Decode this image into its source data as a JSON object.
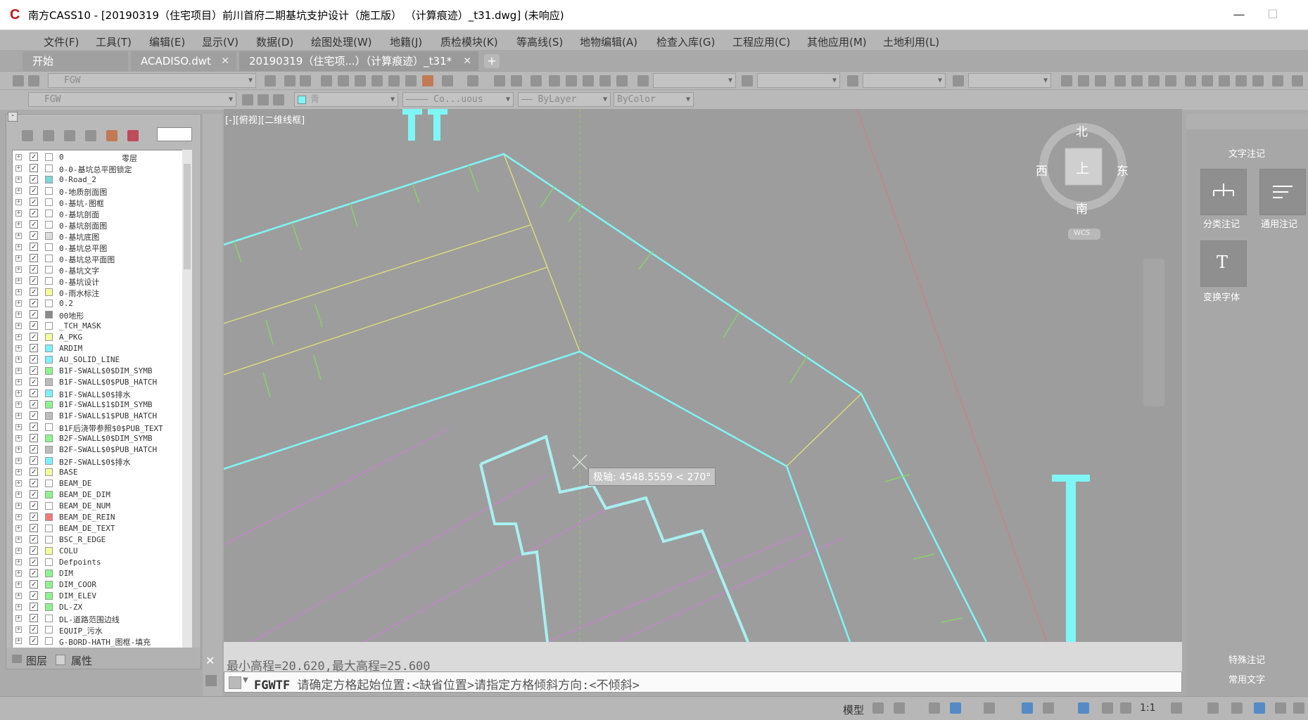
{
  "window": {
    "title": "南方CASS10 - [20190319（住宅项目）前川首府二期基坑支护设计（施工版） （计算痕迹）_t31.dwg] (未响应)",
    "minimize": "—",
    "maximize": "☐",
    "close": ""
  },
  "menu": [
    "文件(F)",
    "工具(T)",
    "编辑(E)",
    "显示(V)",
    "数据(D)",
    "绘图处理(W)",
    "地籍(J)",
    "质检模块(K)",
    "等高线(S)",
    "地物编辑(A)",
    "检查入库(G)",
    "工程应用(C)",
    "其他应用(M)",
    "土地利用(L)"
  ],
  "tabs": [
    {
      "label": "开始"
    },
    {
      "label": "ACADISO.dwt"
    },
    {
      "label": "20190319（住宅项...）（计算痕迹）_t31*"
    }
  ],
  "tab_add": "+",
  "toolbar": {
    "layer_combo_1": "FGW",
    "layer_combo_2": "FGW",
    "color_combo": "青",
    "linetype_combo": "———— Co...uous",
    "lineweight_combo": "—— ByLayer",
    "plotstyle_combo": "ByColor"
  },
  "layers": [
    {
      "name": "0",
      "desc": "零层",
      "color": "#ffffff"
    },
    {
      "name": "0-0-基坑总平图锁定",
      "desc": "",
      "color": "#ffffff"
    },
    {
      "name": "0-Road_2",
      "desc": "",
      "color": "#7fd6d6"
    },
    {
      "name": "0-地质剖面图",
      "desc": "",
      "color": "#ffffff"
    },
    {
      "name": "0-基坑-图框",
      "desc": "",
      "color": "#ffffff"
    },
    {
      "name": "0-基坑剖面",
      "desc": "",
      "color": "#ffffff"
    },
    {
      "name": "0-基坑剖面图",
      "desc": "",
      "color": "#ffffff"
    },
    {
      "name": "0-基坑底图",
      "desc": "",
      "color": "#dddddd"
    },
    {
      "name": "0-基坑总平图",
      "desc": "",
      "color": "#ffffff"
    },
    {
      "name": "0-基坑总平面图",
      "desc": "",
      "color": "#ffffff"
    },
    {
      "name": "0-基坑文字",
      "desc": "",
      "color": "#ffffff"
    },
    {
      "name": "0-基坑设计",
      "desc": "",
      "color": "#ffffff"
    },
    {
      "name": "0-雨水标注",
      "desc": "",
      "color": "#f4ff9a"
    },
    {
      "name": "0.2",
      "desc": "",
      "color": "#ffffff"
    },
    {
      "name": "00地形",
      "desc": "",
      "color": "#8a8a8a"
    },
    {
      "name": "_TCH_MASK",
      "desc": "",
      "color": "#ffffff"
    },
    {
      "name": "A_PKG",
      "desc": "",
      "color": "#f4ff9a"
    },
    {
      "name": "ARDIM",
      "desc": "",
      "color": "#7ff0ff"
    },
    {
      "name": "AU_SOLID_LINE",
      "desc": "",
      "color": "#7ff0ff"
    },
    {
      "name": "B1F-SWALL$0$DIM_SYMB",
      "desc": "",
      "color": "#8cf58c"
    },
    {
      "name": "B1F-SWALL$0$PUB_HATCH",
      "desc": "",
      "color": "#bdbdbd"
    },
    {
      "name": "B1F-SWALL$0$排水",
      "desc": "",
      "color": "#7ff0ff"
    },
    {
      "name": "B1F-SWALL$1$DIM_SYMB",
      "desc": "",
      "color": "#8cf58c"
    },
    {
      "name": "B1F-SWALL$1$PUB_HATCH",
      "desc": "",
      "color": "#bdbdbd"
    },
    {
      "name": "B1F后浇带参照$0$PUB_TEXT",
      "desc": "",
      "color": "#ffffff"
    },
    {
      "name": "B2F-SWALL$0$DIM_SYMB",
      "desc": "",
      "color": "#8cf58c"
    },
    {
      "name": "B2F-SWALL$0$PUB_HATCH",
      "desc": "",
      "color": "#bdbdbd"
    },
    {
      "name": "B2F-SWALL$0$排水",
      "desc": "",
      "color": "#7ff0ff"
    },
    {
      "name": "BASE",
      "desc": "",
      "color": "#f4ff9a"
    },
    {
      "name": "BEAM_DE",
      "desc": "",
      "color": "#ffffff"
    },
    {
      "name": "BEAM_DE_DIM",
      "desc": "",
      "color": "#8cf58c"
    },
    {
      "name": "BEAM_DE_NUM",
      "desc": "",
      "color": "#ffffff"
    },
    {
      "name": "BEAM_DE_REIN",
      "desc": "",
      "color": "#f07a7a"
    },
    {
      "name": "BEAM_DE_TEXT",
      "desc": "",
      "color": "#ffffff"
    },
    {
      "name": "BSC_R_EDGE",
      "desc": "",
      "color": "#ffffff"
    },
    {
      "name": "COLU",
      "desc": "",
      "color": "#f4ff9a"
    },
    {
      "name": "Defpoints",
      "desc": "",
      "color": "#ffffff"
    },
    {
      "name": "DIM",
      "desc": "",
      "color": "#8cf58c"
    },
    {
      "name": "DIM_COOR",
      "desc": "",
      "color": "#8cf58c"
    },
    {
      "name": "DIM_ELEV",
      "desc": "",
      "color": "#8cf58c"
    },
    {
      "name": "DL-ZX",
      "desc": "",
      "color": "#8cf58c"
    },
    {
      "name": "DL-道路范围边线",
      "desc": "",
      "color": "#ffffff"
    },
    {
      "name": "EQUIP_污水",
      "desc": "",
      "color": "#ffffff"
    },
    {
      "name": "G-BORD-HATH_图框-填充",
      "desc": "",
      "color": "#ffffff"
    }
  ],
  "panel_tabs": {
    "layers": "图层",
    "properties": "属性"
  },
  "canvas": {
    "view_label": "[-][俯视][二维线框]",
    "tooltip": "极轴: 4548.5559 < 270°",
    "compass": {
      "north": "北",
      "south": "南",
      "east": "东",
      "west": "西",
      "top": "上",
      "wcs": "WCS"
    }
  },
  "command": {
    "history": "最小高程=20.620,最大高程=25.600",
    "name": "FGWTF",
    "prompt": "请确定方格起始位置:<缺省位置>请指定方格倾斜方向:<不倾斜>"
  },
  "right_panel": {
    "title": "文字注记",
    "btn1": "分类注记",
    "btn2": "通用注记",
    "btn3": "变换字体",
    "btn3_glyph": "T",
    "bottom1": "特殊注记",
    "bottom2": "常用文字"
  },
  "status": {
    "model": "模型",
    "scale": "1:1"
  },
  "colors": {
    "cyan": "#7ff6f6",
    "yellow": "#dede7a",
    "green": "#8ad16b",
    "magenta": "#d47ae0",
    "red": "#d67b7b"
  }
}
